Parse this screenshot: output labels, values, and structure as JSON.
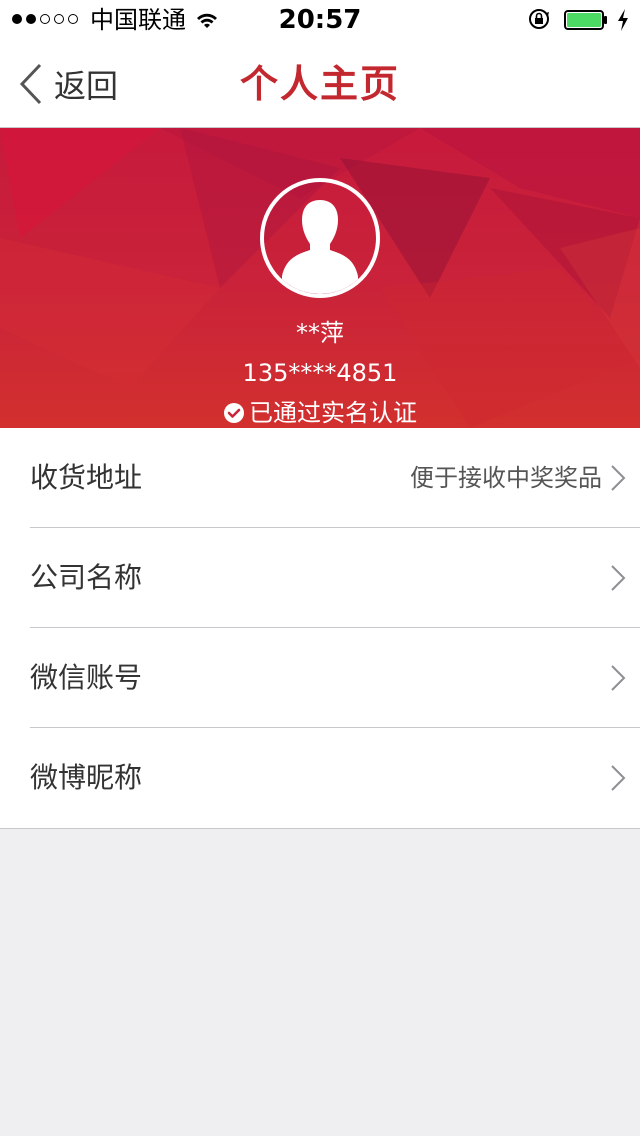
{
  "status_bar": {
    "signal_filled": 2,
    "signal_total": 5,
    "carrier": "中国联通",
    "time": "20:57",
    "battery_level": 1.0,
    "icons": [
      "wifi-icon",
      "rotation-lock-icon",
      "battery-icon",
      "charging-icon"
    ]
  },
  "nav": {
    "back_label": "返回",
    "title": "个人主页"
  },
  "profile": {
    "name": "**萍",
    "phone": "135****4851",
    "verified_text": "已通过实名认证"
  },
  "list": {
    "items": [
      {
        "label": "收货地址",
        "hint": "便于接收中奖奖品"
      },
      {
        "label": "公司名称",
        "hint": ""
      },
      {
        "label": "微信账号",
        "hint": ""
      },
      {
        "label": "微博昵称",
        "hint": ""
      }
    ]
  },
  "colors": {
    "accent": "#c3282f",
    "banner_top": "#c81a3c",
    "banner_bottom": "#d2302e",
    "page_bg": "#efeff1",
    "battery_fill": "#4cd964"
  }
}
